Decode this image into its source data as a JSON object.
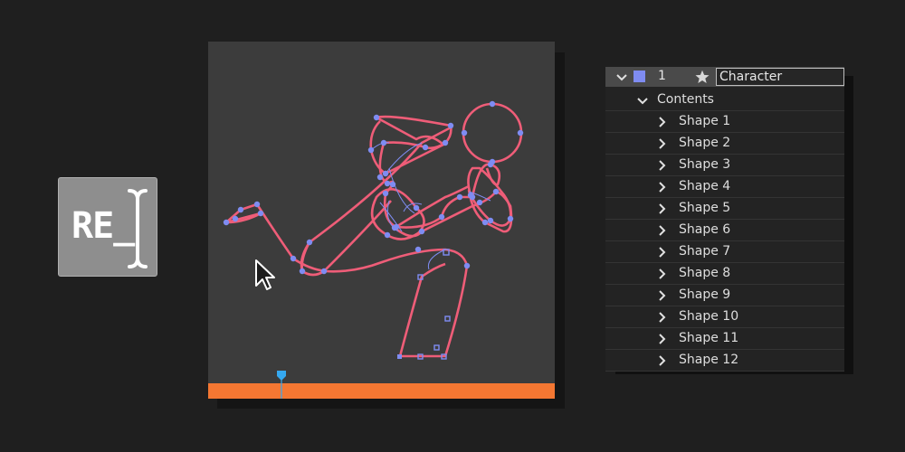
{
  "logo": {
    "text": "RE_"
  },
  "layer": {
    "number": "1",
    "name": "Character",
    "label_color": "#7f8cf2"
  },
  "contents": {
    "label": "Contents"
  },
  "shapes": [
    "Shape 1",
    "Shape 2",
    "Shape 3",
    "Shape 4",
    "Shape 5",
    "Shape 6",
    "Shape 7",
    "Shape 8",
    "Shape 9",
    "Shape 10",
    "Shape 11",
    "Shape 12"
  ],
  "colors": {
    "path_stroke": "#ef5d78",
    "vertex": "#7f8cf2",
    "timeline": "#f47732",
    "playhead": "#35a8f0"
  }
}
